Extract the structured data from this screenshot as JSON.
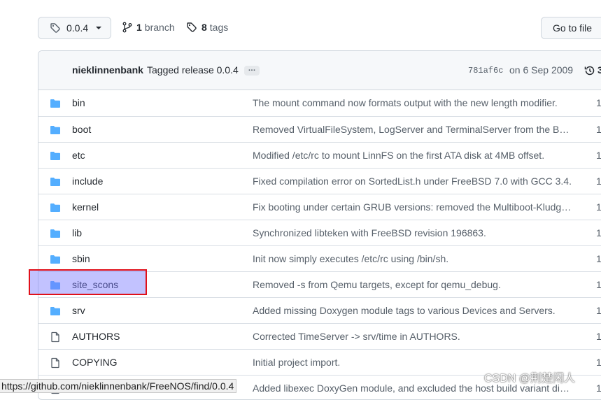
{
  "branch_button": {
    "label": "0.0.4",
    "icon": "tag-icon"
  },
  "branches": {
    "count": "1",
    "label": "branch"
  },
  "tags": {
    "count": "8",
    "label": "tags"
  },
  "goto_button": {
    "label": "Go to file"
  },
  "commit": {
    "author": "nieklinnenbank",
    "message": "Tagged release 0.0.4",
    "ellipsis": "…",
    "hash": "781af6c",
    "date": "on 6 Sep 2009",
    "history_count": "3"
  },
  "files": [
    {
      "name": "bin",
      "type": "folder",
      "message": "The mount command now formats output with the new length modifier.",
      "age": "1"
    },
    {
      "name": "boot",
      "type": "folder",
      "message": "Removed VirtualFileSystem, LogServer and TerminalServer from the B…",
      "age": "1"
    },
    {
      "name": "etc",
      "type": "folder",
      "message": "Modified /etc/rc to mount LinnFS on the first ATA disk at 4MB offset.",
      "age": "1"
    },
    {
      "name": "include",
      "type": "folder",
      "message": "Fixed compilation error on SortedList.h under FreeBSD 7.0 with GCC 3.4.",
      "age": "1"
    },
    {
      "name": "kernel",
      "type": "folder",
      "message": "Fix booting under certain GRUB versions: removed the Multiboot-Kludg…",
      "age": "1"
    },
    {
      "name": "lib",
      "type": "folder",
      "message": "Synchronized libteken with FreeBSD revision 196863.",
      "age": "1"
    },
    {
      "name": "sbin",
      "type": "folder",
      "message": "Init now simply executes /etc/rc using /bin/sh.",
      "age": "1"
    },
    {
      "name": "site_scons",
      "type": "folder",
      "message": "Removed -s from Qemu targets, except for qemu_debug.",
      "age": "1"
    },
    {
      "name": "srv",
      "type": "folder",
      "message": "Added missing Doxygen module tags to various Devices and Servers.",
      "age": "1"
    },
    {
      "name": "AUTHORS",
      "type": "file",
      "message": "Corrected TimeServer -> srv/time in AUTHORS.",
      "age": "1"
    },
    {
      "name": "COPYING",
      "type": "file",
      "message": "Initial project import.",
      "age": "1"
    },
    {
      "name": "",
      "type": "file",
      "message": "Added libexec DoxyGen module, and excluded the host build variant di…",
      "age": "1"
    }
  ],
  "status_url": "https://github.com/nieklinnenbank/FreeNOS/find/0.0.4",
  "watermark": "CSDN @荆楚闲人",
  "colors": {
    "folder": "#54aeff",
    "file_icon": "#57606a",
    "highlight_border": "#e0101a"
  }
}
